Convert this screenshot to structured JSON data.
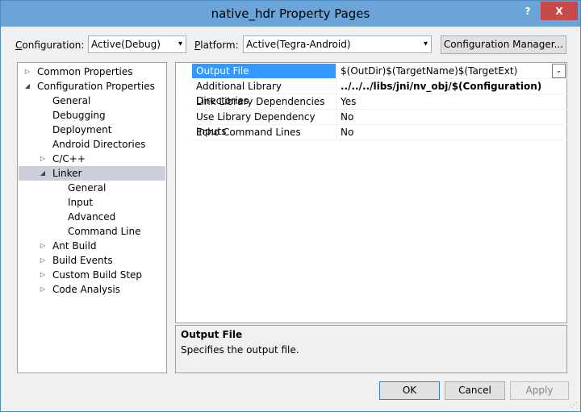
{
  "window": {
    "title": "native_hdr Property Pages",
    "help_label": "?",
    "close_label": "X"
  },
  "toolbar": {
    "configuration_label_prefix": "C",
    "configuration_label_rest": "onfiguration:",
    "configuration_value": "Active(Debug)",
    "platform_label_prefix": "P",
    "platform_label_rest": "latform:",
    "platform_value": "Active(Tegra-Android)",
    "config_manager_label": "Configuration Manager..."
  },
  "tree": {
    "items": [
      {
        "label": "Common Properties",
        "expander": "▷"
      },
      {
        "label": "Configuration Properties",
        "expander": "◢"
      },
      {
        "label": "General"
      },
      {
        "label": "Debugging"
      },
      {
        "label": "Deployment"
      },
      {
        "label": "Android Directories"
      },
      {
        "label": "C/C++",
        "expander": "▷"
      },
      {
        "label": "Linker",
        "expander": "◢"
      },
      {
        "label": "General"
      },
      {
        "label": "Input"
      },
      {
        "label": "Advanced"
      },
      {
        "label": "Command Line"
      },
      {
        "label": "Ant Build",
        "expander": "▷"
      },
      {
        "label": "Build Events",
        "expander": "▷"
      },
      {
        "label": "Custom Build Step",
        "expander": "▷"
      },
      {
        "label": "Code Analysis",
        "expander": "▷"
      }
    ]
  },
  "grid": {
    "rows": [
      {
        "name": "Output File",
        "value": "$(OutDir)$(TargetName)$(TargetExt)"
      },
      {
        "name": "Additional Library Directories",
        "value": "../../../libs/jni/nv_obj/$(Configuration)"
      },
      {
        "name": "Link Library Dependencies",
        "value": "Yes"
      },
      {
        "name": "Use Library Dependency Inputs",
        "value": "No"
      },
      {
        "name": "Echo Command Lines",
        "value": "No"
      }
    ]
  },
  "description": {
    "title": "Output File",
    "text": "Specifies the output file."
  },
  "buttons": {
    "ok": "OK",
    "cancel": "Cancel",
    "apply": "Apply"
  },
  "icons": {
    "dropdown": "▾",
    "value_dropdown": "⌄"
  },
  "colors": {
    "titlebar": "#6aa4d8",
    "close": "#c74a4a",
    "selection": "#3399ff",
    "tree_selection": "#cccedb"
  }
}
